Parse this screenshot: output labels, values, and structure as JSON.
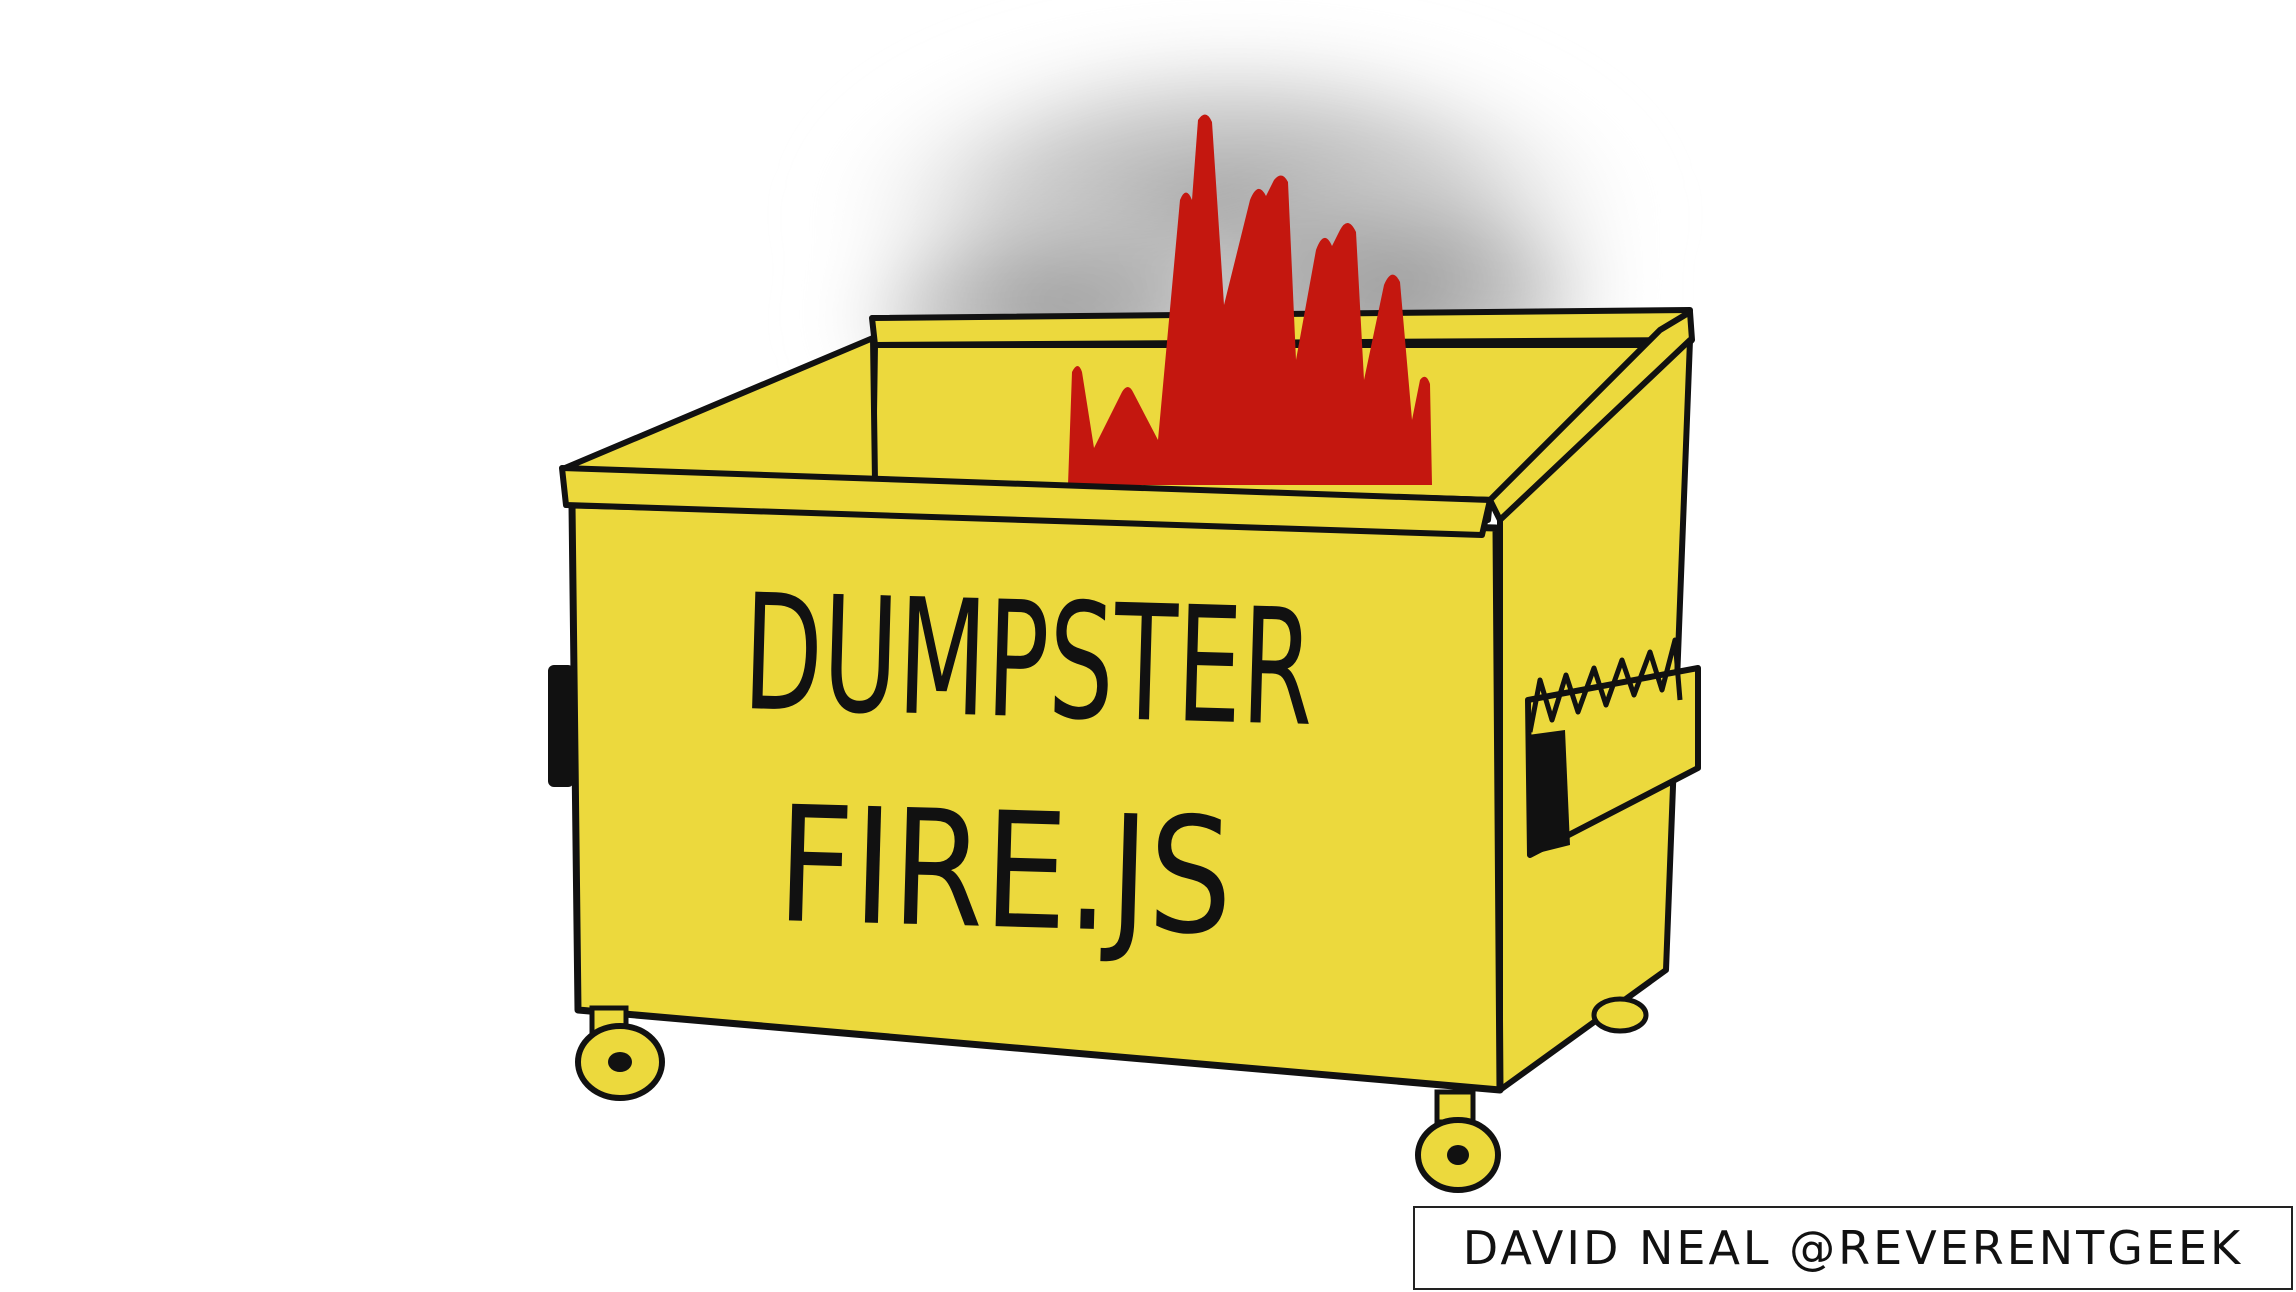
{
  "illustration": {
    "label_line1": "DUMPSTER",
    "label_line2": "FIRE.JS",
    "dumpster_color": "#ecd93d",
    "flame_color": "#c4170f",
    "smoke_color": "#9a9a9a",
    "outline_color": "#111111"
  },
  "credit": {
    "text": "DAVID NEAL @REVERENTGEEK"
  }
}
